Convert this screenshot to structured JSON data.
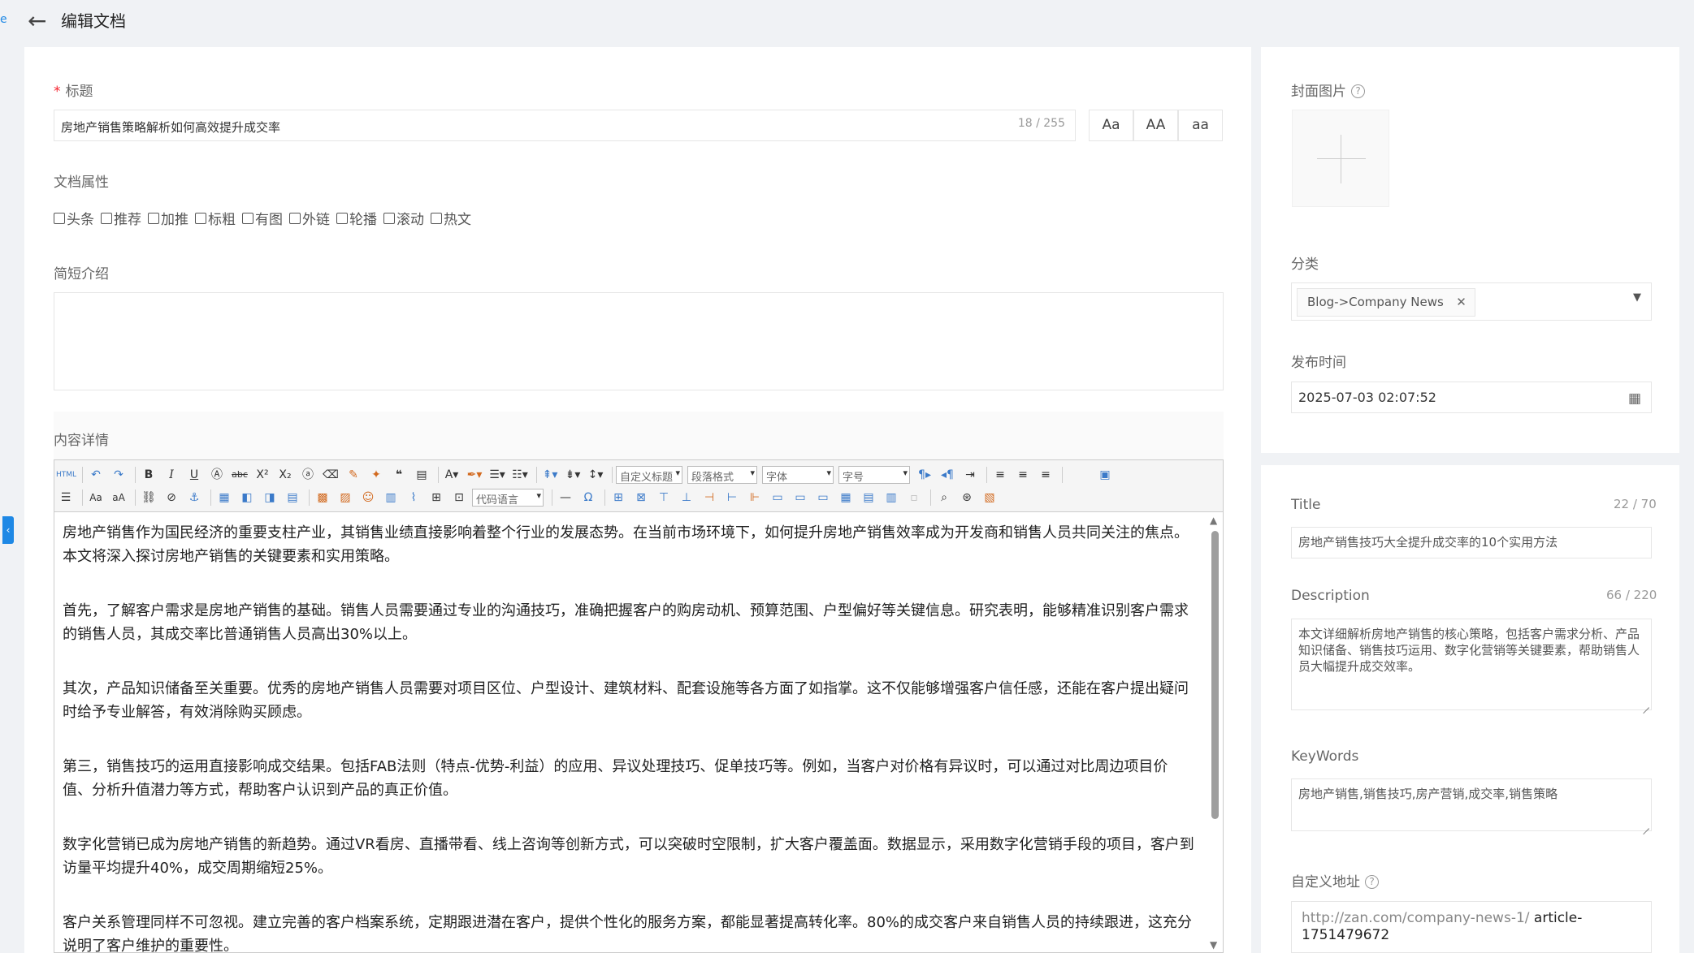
{
  "header": {
    "title": "编辑文档",
    "edge_mark": "e"
  },
  "form": {
    "title_label": "标题",
    "title_value": "房地产销售策略解析如何高效提升成交率",
    "title_count": "18 / 255",
    "case_buttons": [
      "Aa",
      "AA",
      "aa"
    ],
    "attrs_label": "文档属性",
    "attrs": [
      "头条",
      "推荐",
      "加推",
      "标粗",
      "有图",
      "外链",
      "轮播",
      "滚动",
      "热文"
    ],
    "intro_label": "简短介绍",
    "content_label": "内容详情"
  },
  "editor": {
    "selects": {
      "custom_title": "自定义标题",
      "paragraph": "段落格式",
      "font": "字体",
      "size": "字号",
      "code_lang": "代码语言"
    },
    "paragraphs": [
      "房地产销售作为国民经济的重要支柱产业，其销售业绩直接影响着整个行业的发展态势。在当前市场环境下，如何提升房地产销售效率成为开发商和销售人员共同关注的焦点。本文将深入探讨房地产销售的关键要素和实用策略。",
      "首先，了解客户需求是房地产销售的基础。销售人员需要通过专业的沟通技巧，准确把握客户的购房动机、预算范围、户型偏好等关键信息。研究表明，能够精准识别客户需求的销售人员，其成交率比普通销售人员高出30%以上。",
      "其次，产品知识储备至关重要。优秀的房地产销售人员需要对项目区位、户型设计、建筑材料、配套设施等各方面了如指掌。这不仅能够增强客户信任感，还能在客户提出疑问时给予专业解答，有效消除购买顾虑。",
      "第三，销售技巧的运用直接影响成交结果。包括FAB法则（特点-优势-利益）的应用、异议处理技巧、促单技巧等。例如，当客户对价格有异议时，可以通过对比周边项目价值、分析升值潜力等方式，帮助客户认识到产品的真正价值。",
      "数字化营销已成为房地产销售的新趋势。通过VR看房、直播带看、线上咨询等创新方式，可以突破时空限制，扩大客户覆盖面。数据显示，采用数字化营销手段的项目，客户到访量平均提升40%，成交周期缩短25%。",
      "客户关系管理同样不可忽视。建立完善的客户档案系统，定期跟进潜在客户，提供个性化的服务方案，都能显著提高转化率。80%的成交客户来自销售人员的持续跟进，这充分说明了客户维护的重要性。"
    ]
  },
  "sidebar": {
    "cover_label": "封面图片",
    "category_label": "分类",
    "category_tag": "Blog->Company News",
    "publish_label": "发布时间",
    "publish_value": "2025-07-03 02:07:52",
    "seo_title_label": "Title",
    "seo_title_count": "22 / 70",
    "seo_title_value": "房地产销售技巧大全提升成交率的10个实用方法",
    "description_label": "Description",
    "description_count": "66 / 220",
    "description_value": "本文详细解析房地产销售的核心策略，包括客户需求分析、产品知识储备、销售技巧运用、数字化营销等关键要素，帮助销售人员大幅提升成交效率。",
    "keywords_label": "KeyWords",
    "keywords_value": "房地产销售,销售技巧,房产营销,成交率,销售策略",
    "url_label": "自定义地址",
    "url_prefix": "http://zan.com/company-news-1/",
    "url_slug": "article-1751479672"
  },
  "icons": {
    "back": "arrow-left-icon",
    "help": "question-circle-icon",
    "calendar": "calendar-icon",
    "close": "close-icon",
    "dropdown": "caret-down-icon",
    "collapse": "chevron-left-icon"
  },
  "colors": {
    "accent": "#1e88e5",
    "required": "#f5222d"
  }
}
